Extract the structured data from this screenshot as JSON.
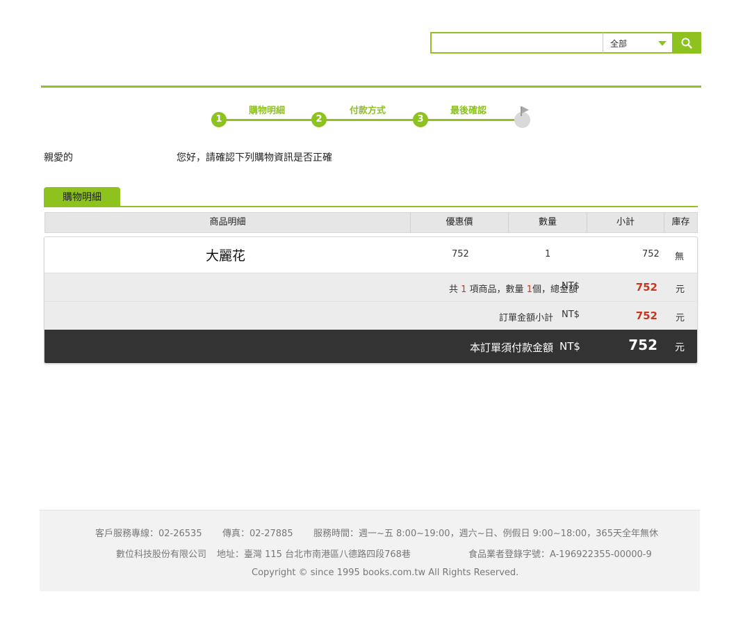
{
  "search": {
    "category": "全部"
  },
  "steps": [
    {
      "num": "1",
      "label": "購物明細"
    },
    {
      "num": "2",
      "label": "付款方式"
    },
    {
      "num": "3",
      "label": "最後確認"
    }
  ],
  "greeting": {
    "salutation": "親愛的",
    "message": "您好，請確認下列購物資訊是否正確"
  },
  "tab": {
    "label": "購物明細"
  },
  "table": {
    "headers": {
      "product": "商品明細",
      "price": "優惠價",
      "qty": "數量",
      "subtotal": "小計",
      "stock": "庫存"
    },
    "item": {
      "name": "大麗花",
      "price": "752",
      "qty": "1",
      "subtotal": "752",
      "stock": "無"
    }
  },
  "summary": {
    "count_prefix": "共",
    "count_items": "1",
    "count_mid": "項商品，數量",
    "count_qty": "1",
    "count_suffix": "個，總金額",
    "currency": "NT$",
    "total": "752",
    "unit": "元",
    "order_label": "訂單金額小計",
    "order_total": "752",
    "pay_label": "本訂單須付款金額",
    "pay_total": "752"
  },
  "footer": {
    "service": "客戶服務專線：02-26535",
    "fax": "傳真：02-27885",
    "hours": "服務時間：週一~五 8:00~19:00，週六~日、例假日 9:00~18:00，365天全年無休",
    "company": "數位科技股份有限公司",
    "address": "地址：臺灣 115 台北市南港區八德路四段768巷",
    "license": "食品業者登錄字號：A-196922355-00000-9",
    "copyright": "Copyright © since 1995 books.com.tw All Rights Reserved."
  },
  "colors": {
    "accent": "#8dc21f",
    "price_red": "#c8361d",
    "dark_bar": "#333333"
  }
}
